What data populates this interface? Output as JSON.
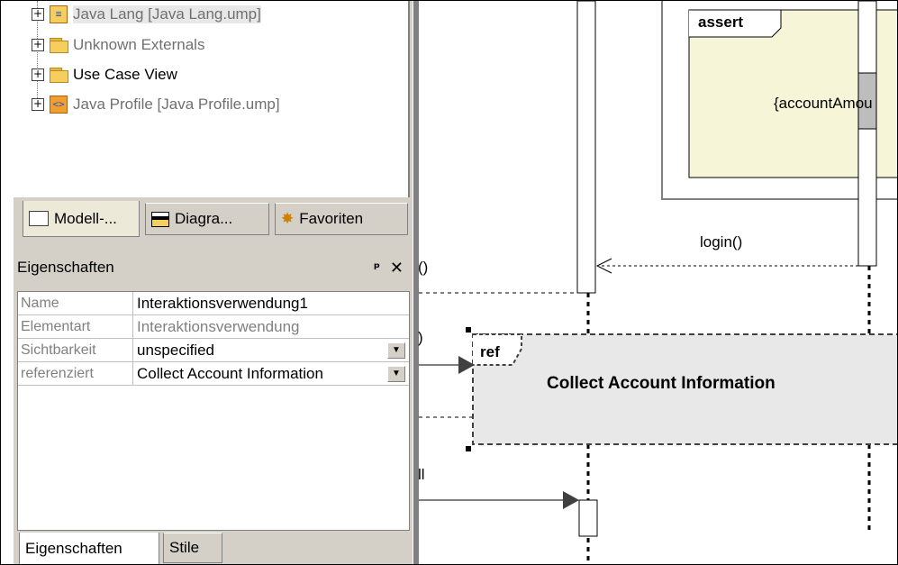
{
  "tree": {
    "items": [
      {
        "label": "Java Lang [Java Lang.ump]",
        "icon": "package-icon"
      },
      {
        "label": "Unknown Externals",
        "icon": "folder-icon"
      },
      {
        "label": "Use Case View",
        "icon": "folder-icon"
      },
      {
        "label": "Java Profile [Java Profile.ump]",
        "icon": "profile-icon"
      }
    ]
  },
  "tabs": {
    "model": "Modell-...",
    "diagrams": "Diagra...",
    "favorites": "Favoriten"
  },
  "properties": {
    "title": "Eigenschaften",
    "pin_glyph": "Җ",
    "close_glyph": "✕",
    "rows": [
      {
        "key": "Name",
        "value": "Interaktionsverwendung1"
      },
      {
        "key": "Elementart",
        "value": "Interaktionsverwendung"
      },
      {
        "key": "Sichtbarkeit",
        "value": "unspecified"
      },
      {
        "key": "referenziert",
        "value": "Collect Account Information"
      }
    ]
  },
  "bottom_tabs": {
    "properties": "Eigenschaften",
    "styles": "Stile"
  },
  "diagram": {
    "assert_label": "assert",
    "guard_text": "{accountAmou",
    "login_label": "login()",
    "ref_label": "ref",
    "ref_title": "Collect Account Information",
    "fragment_paren1": "()",
    "fragment_paren2": ")",
    "fragment_all": "ll"
  },
  "colors": {
    "panel": "#d4d0c8",
    "fragment_fill": "#f7f5d8",
    "ref_fill": "#e8e8e8"
  }
}
